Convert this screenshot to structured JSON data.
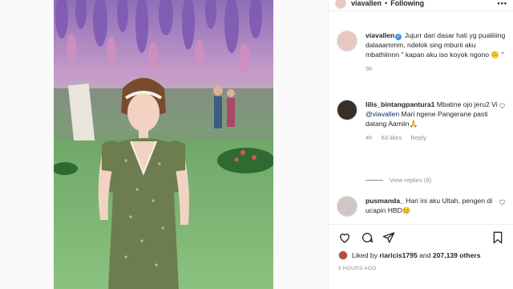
{
  "header": {
    "username": "viavallen",
    "separator": "•",
    "follow_status": "Following",
    "more": "•••"
  },
  "caption": {
    "username": "viavallen",
    "verified_mark": "✓",
    "text": " Jujurr dari dasar hati yg pualiiiing dalaaammm, ndelok sing mburii aku mbathiinnn \" kapan aku iso koyok ngono 🙃 \"",
    "time": "9h"
  },
  "comments": [
    {
      "username": "lilis_bintangpantura1",
      "text_before": " Mbatine ojo jeru2 Vi ",
      "mention": "@viavallen",
      "text_after": " Mari ngene Pangerane pasti datang Aamiin🙏",
      "time": "4h",
      "likes": "63 likes",
      "reply": "Reply",
      "view_replies": "View replies (8)"
    },
    {
      "username": "pusmanda_",
      "text": " Hari ini aku Ultah, pengen di ucapin HBD😊"
    }
  ],
  "likes": {
    "prefix": "Liked by ",
    "user": "riaricis1795",
    "middle": " and ",
    "count": "207,139 others"
  },
  "posted_ago": "9 HOURS AGO",
  "icons": {
    "like": "heart-icon",
    "comment": "comment-icon",
    "share": "share-icon",
    "save": "bookmark-icon"
  },
  "colors": {
    "link": "#003569",
    "verified": "#3897f0",
    "muted": "#8e8e8e"
  }
}
